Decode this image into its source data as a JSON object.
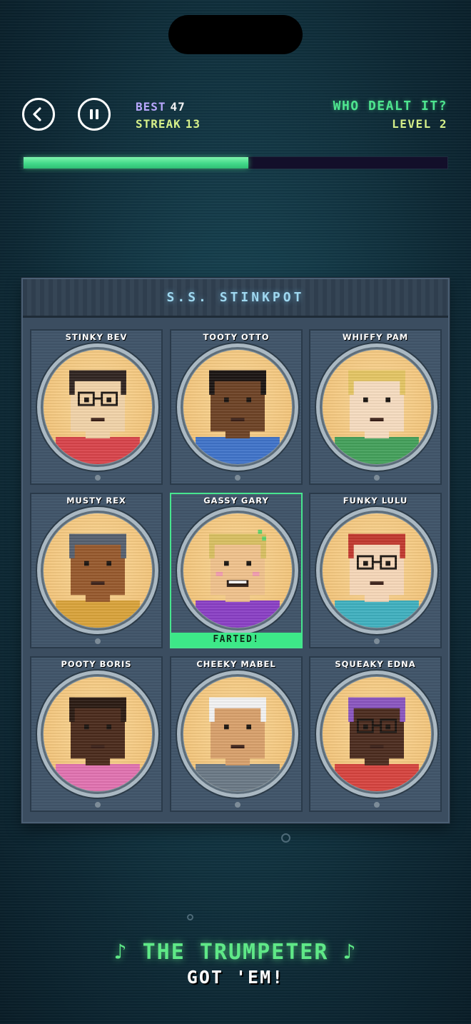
{
  "hud": {
    "best_label": "BEST",
    "best_value": "47",
    "streak_label": "STREAK",
    "streak_value": "13",
    "game_title": "WHO DEALT IT?",
    "level_label": "LEVEL 2",
    "progress": 0.53
  },
  "ship": {
    "name": "S.S. STINKPOT",
    "suspects": [
      {
        "name": "STINKY BEV",
        "skin": "#f1d3a8",
        "hair": "#2f2420",
        "shirt": "#d8434a",
        "glasses": true,
        "selected": false
      },
      {
        "name": "TOOTY OTTO",
        "skin": "#6d4225",
        "hair": "#1a1412",
        "shirt": "#3f73c9",
        "glasses": false,
        "selected": false
      },
      {
        "name": "WHIFFY PAM",
        "skin": "#f6dcc0",
        "hair": "#e4c563",
        "shirt": "#43a05a",
        "glasses": false,
        "selected": false
      },
      {
        "name": "MUSTY REX",
        "skin": "#97592c",
        "hair": "#55606f",
        "shirt": "#d9a33a",
        "glasses": false,
        "selected": false
      },
      {
        "name": "GASSY GARY",
        "skin": "#f0c28c",
        "hair": "#d8c061",
        "shirt": "#8a3fc5",
        "glasses": false,
        "selected": true
      },
      {
        "name": "FUNKY LULU",
        "skin": "#f6d7b8",
        "hair": "#c2382e",
        "shirt": "#3fb0bf",
        "glasses": true,
        "selected": false
      },
      {
        "name": "POOTY BORIS",
        "skin": "#4a2a1b",
        "hair": "#2a1a12",
        "shirt": "#e172b0",
        "glasses": false,
        "selected": false
      },
      {
        "name": "CHEEKY MABEL",
        "skin": "#d8a06b",
        "hair": "#f2f2f2",
        "shirt": "#6a7885",
        "glasses": false,
        "selected": false
      },
      {
        "name": "SQUEAKY EDNA",
        "skin": "#4b2b1e",
        "hair": "#8a55c0",
        "shirt": "#d6433e",
        "glasses": true,
        "selected": false
      }
    ],
    "culprit_tag": "FARTED!"
  },
  "result": {
    "line1": "♪ THE TRUMPETER ♪",
    "line2": "GOT 'EM!"
  },
  "colors": {
    "accent_green": "#4ee58f",
    "best_purple": "#b9a8ff",
    "streak_yellow": "#d6f08a"
  },
  "icons": [
    "back-icon",
    "pause-icon"
  ]
}
